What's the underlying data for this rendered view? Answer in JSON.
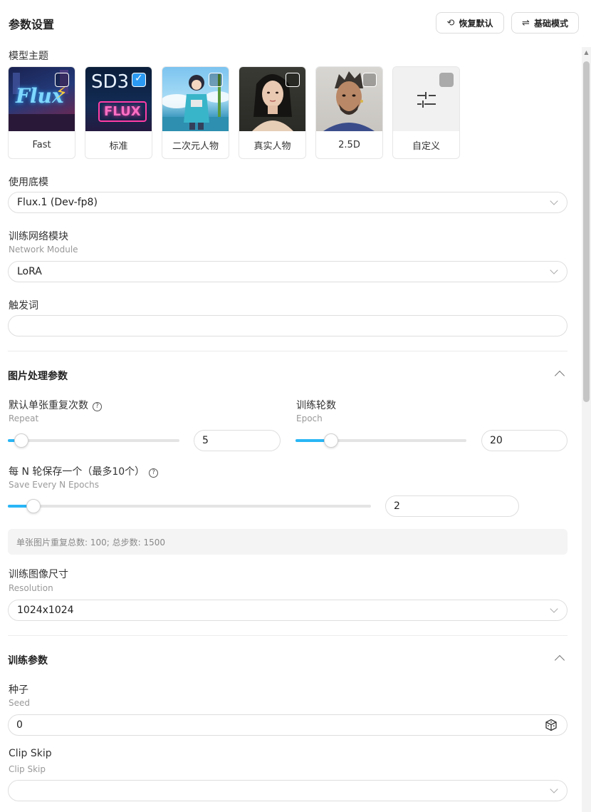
{
  "header": {
    "title": "参数设置",
    "reset_label": "恢复默认",
    "mode_label": "基础模式"
  },
  "theme": {
    "label": "模型主题",
    "cards": [
      {
        "caption": "Fast",
        "checked": false
      },
      {
        "caption": "标准",
        "checked": true
      },
      {
        "caption": "二次元人物",
        "checked": false
      },
      {
        "caption": "真实人物",
        "checked": false
      },
      {
        "caption": "2.5D",
        "checked": false
      },
      {
        "caption": "自定义",
        "checked": false
      }
    ],
    "thumb_text": {
      "flux": "Flux",
      "sd3": "SD3",
      "flux2": "FLUX"
    }
  },
  "base_model": {
    "label": "使用底模",
    "value": "Flux.1 (Dev-fp8)"
  },
  "network": {
    "label": "训练网络模块",
    "sublabel": "Network Module",
    "value": "LoRA"
  },
  "trigger": {
    "label": "触发词",
    "value": ""
  },
  "image_section": {
    "title": "图片处理参数",
    "repeat": {
      "label": "默认单张重复次数",
      "sublabel": "Repeat",
      "value": "5",
      "fraction": 0.08
    },
    "epoch": {
      "label": "训练轮数",
      "sublabel": "Epoch",
      "value": "20",
      "fraction": 0.21
    },
    "save_every": {
      "label": "每 N 轮保存一个（最多10个）",
      "sublabel": "Save Every N Epochs",
      "value": "2",
      "fraction": 0.07
    },
    "summary": "单张图片重复总数: 100;  总步数: 1500",
    "resolution": {
      "label": "训练图像尺寸",
      "sublabel": "Resolution",
      "value": "1024x1024"
    }
  },
  "train_section": {
    "title": "训练参数",
    "seed": {
      "label": "种子",
      "sublabel": "Seed",
      "value": "0"
    },
    "clip_skip": {
      "label": "Clip Skip",
      "sublabel": "Clip Skip",
      "value": ""
    }
  },
  "icons": {
    "reset": "undo-icon",
    "mode": "swap-icon",
    "help": "help-circle-icon",
    "dice": "dice-icon",
    "chevron": "chevron-down-icon",
    "collapse": "chevron-up-icon",
    "custom": "sliders-icon"
  },
  "colors": {
    "accent": "#29b6f6",
    "check": "#2b9af3"
  }
}
